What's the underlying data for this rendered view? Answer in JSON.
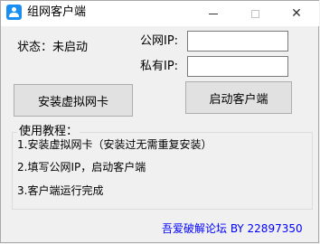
{
  "window": {
    "title": "组网客户端",
    "minimize_label": "—",
    "maximize_label": "☐",
    "close_label": "✕"
  },
  "status": {
    "label": "状态：未启动"
  },
  "network": {
    "public_ip_label": "公网IP:",
    "public_ip_value": "",
    "private_ip_label": "私有IP:",
    "private_ip_value": ""
  },
  "buttons": {
    "install_label": "安装虚拟网卡",
    "start_label": "启动客户端"
  },
  "tutorial": {
    "title": "使用教程：",
    "steps": [
      "1.安装虚拟网卡（安装过无需重复安装）",
      "2.填写公网IP，启动客户端",
      "3.客户端运行完成"
    ]
  },
  "footer": {
    "text": "吾爱破解论坛 BY 22897350"
  },
  "colors": {
    "accent": "#1a8ff2",
    "footer_link": "#0000ff"
  }
}
